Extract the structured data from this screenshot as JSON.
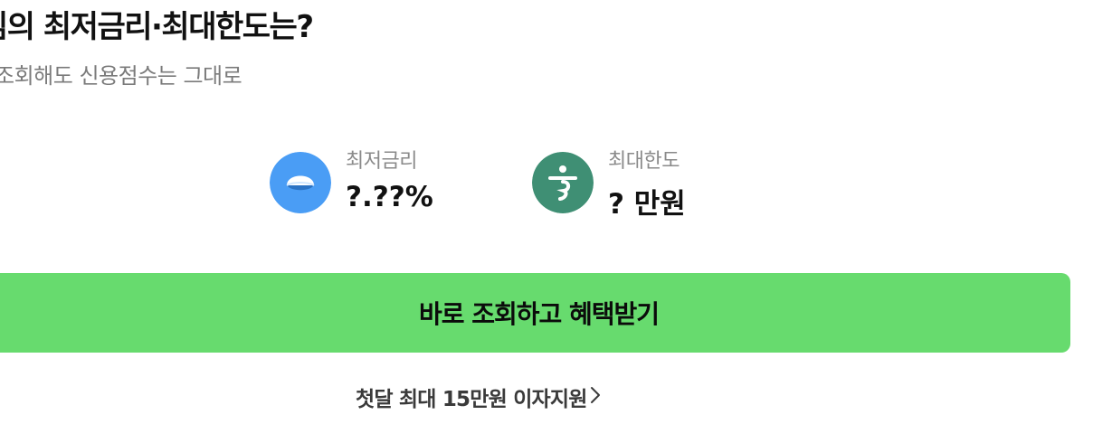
{
  "header": {
    "title": "님의 최저금리·최대한도는?",
    "subtitle": "조회해도 신용점수는 그대로"
  },
  "offers": {
    "rate": {
      "label": "최저금리",
      "value": "?.??%",
      "icon": "blue-bank-logo-icon",
      "icon_color": "#4a9df5"
    },
    "limit": {
      "label": "최대한도",
      "value": "? 만원",
      "icon": "hana-bank-logo-icon",
      "icon_color": "#3f8f74"
    }
  },
  "cta": {
    "label": "바로 조회하고 혜택받기",
    "color": "#67db6e"
  },
  "promo": {
    "label": "첫달 최대 15만원 이자지원"
  }
}
